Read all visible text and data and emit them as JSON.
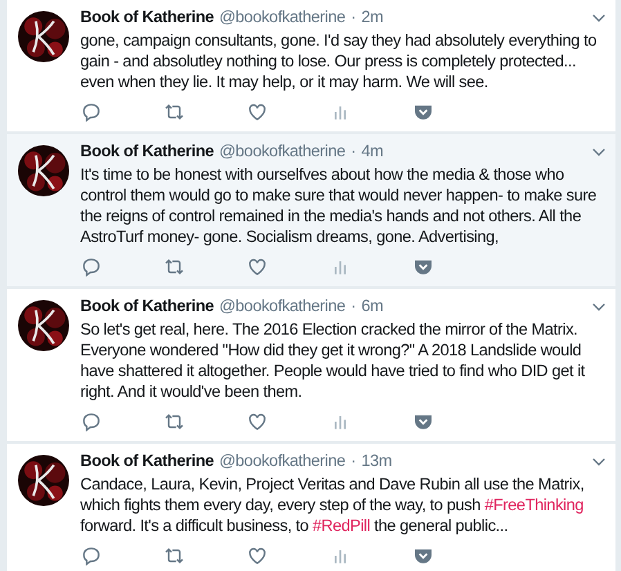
{
  "tweets": [
    {
      "name": "Book of Katherine",
      "handle": "@bookofkatherine",
      "separator": "·",
      "time": "2m",
      "highlighted": false,
      "body": [
        {
          "kind": "text",
          "text": "gone, campaign consultants, gone. I'd say they had absolutely everything to gain - and absolutley nothing to lose. Our press is completely protected... even when they lie. It may help, or it may harm. We will see."
        }
      ]
    },
    {
      "name": "Book of Katherine",
      "handle": "@bookofkatherine",
      "separator": "·",
      "time": "4m",
      "highlighted": true,
      "body": [
        {
          "kind": "text",
          "text": "It's time to be honest with ourselfves about how the media & those who control them would go to make sure that would never happen- to make sure the reigns of control remained in the media's hands and not others. All the AstroTurf money- gone. Socialism dreams, gone. Advertising,"
        }
      ]
    },
    {
      "name": "Book of Katherine",
      "handle": "@bookofkatherine",
      "separator": "·",
      "time": "6m",
      "highlighted": false,
      "body": [
        {
          "kind": "text",
          "text": "So let's get real, here. The 2016 Election cracked the mirror of the Matrix. Everyone wondered \"How did they get it wrong?\" A 2018 Landslide would have shattered it altogether. People would have tried to find who DID get it right. And it would've been them."
        }
      ]
    },
    {
      "name": "Book of Katherine",
      "handle": "@bookofkatherine",
      "separator": "·",
      "time": "13m",
      "highlighted": false,
      "body": [
        {
          "kind": "text",
          "text": "Candace, Laura, Kevin, Project Veritas and Dave Rubin all use the Matrix, which fights them every day, every step of the way, to push "
        },
        {
          "kind": "hashtag",
          "text": "#FreeThinking"
        },
        {
          "kind": "text",
          "text": " forward. It's a difficult business, to "
        },
        {
          "kind": "hashtag",
          "text": "#RedPill"
        },
        {
          "kind": "text",
          "text": " the general public..."
        }
      ]
    }
  ]
}
